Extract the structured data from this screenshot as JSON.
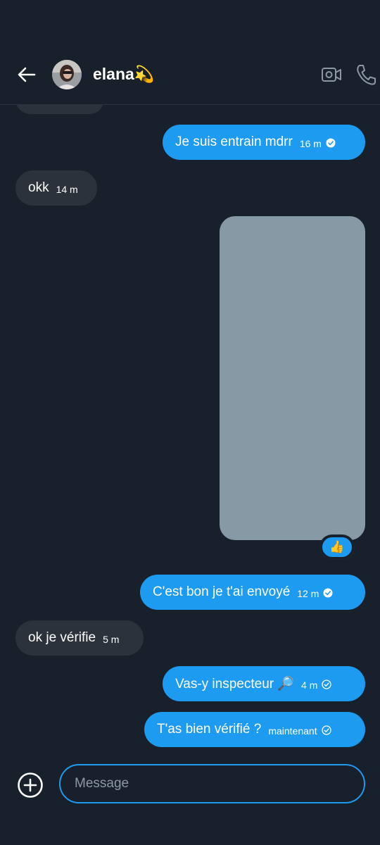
{
  "header": {
    "contact_name": "elana💫",
    "icons": {
      "back": "back-arrow-icon",
      "video": "video-camera-icon",
      "call": "phone-icon"
    }
  },
  "messages": [
    {
      "direction": "out",
      "text": "Je suis entrain mdrr",
      "time": "16 m",
      "status": "seen"
    },
    {
      "direction": "in",
      "text": "okk",
      "time": "14 m"
    },
    {
      "direction": "out",
      "type": "image",
      "reaction": "👍"
    },
    {
      "direction": "out",
      "text": "C'est bon je t'ai envoyé",
      "time": "12 m",
      "status": "seen"
    },
    {
      "direction": "in",
      "text": "ok je vérifie",
      "time": "5 m"
    },
    {
      "direction": "out",
      "text": "Vas-y inspecteur 🔎",
      "time": "4 m",
      "status": "sent"
    },
    {
      "direction": "out",
      "text": "T'as bien vérifié ?",
      "time": "maintenant",
      "status": "sent"
    }
  ],
  "composer": {
    "placeholder": "Message",
    "value": ""
  },
  "colors": {
    "background": "#18202b",
    "outgoing_bubble": "#1d9bf0",
    "incoming_bubble": "#2b323b",
    "image_placeholder": "#8899a6",
    "accent": "#1d9bf0"
  }
}
